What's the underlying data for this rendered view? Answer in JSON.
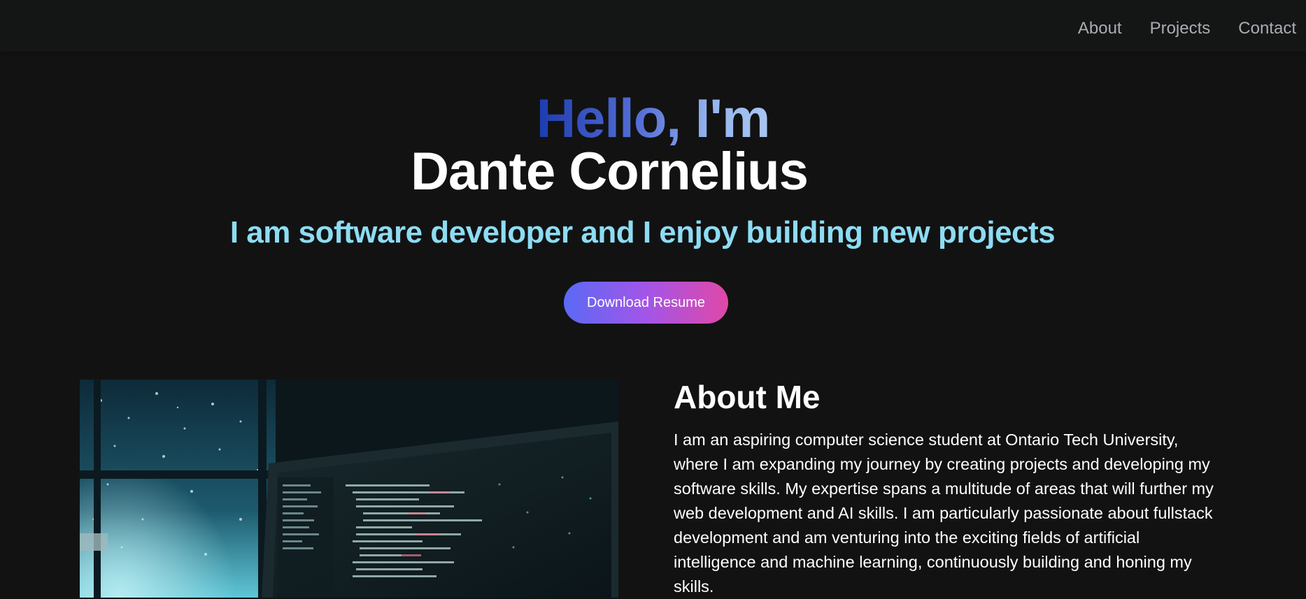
{
  "nav": {
    "links": [
      "About",
      "Projects",
      "Contact"
    ]
  },
  "hero": {
    "greeting": "Hello, I'm",
    "name": "Dante Cornelius",
    "tagline": "I am software developer and I enjoy building new projects",
    "button_label": "Download Resume"
  },
  "about": {
    "title": "About Me",
    "paragraph": "I am an aspiring computer science student at Ontario Tech University, where I am expanding my journey by creating projects and developing my software skills. My expertise spans a multitude of areas that will further my web development and AI skills. I am particularly passionate about fullstack development and am venturing into the exciting fields of artificial intelligence and machine learning, continuously building and honing my skills."
  },
  "colors": {
    "background": "#121212",
    "navbar": "#141615",
    "tagline": "#8ddcf3",
    "button_gradient": [
      "#5a6af5",
      "#a355e8",
      "#e048a8"
    ]
  }
}
